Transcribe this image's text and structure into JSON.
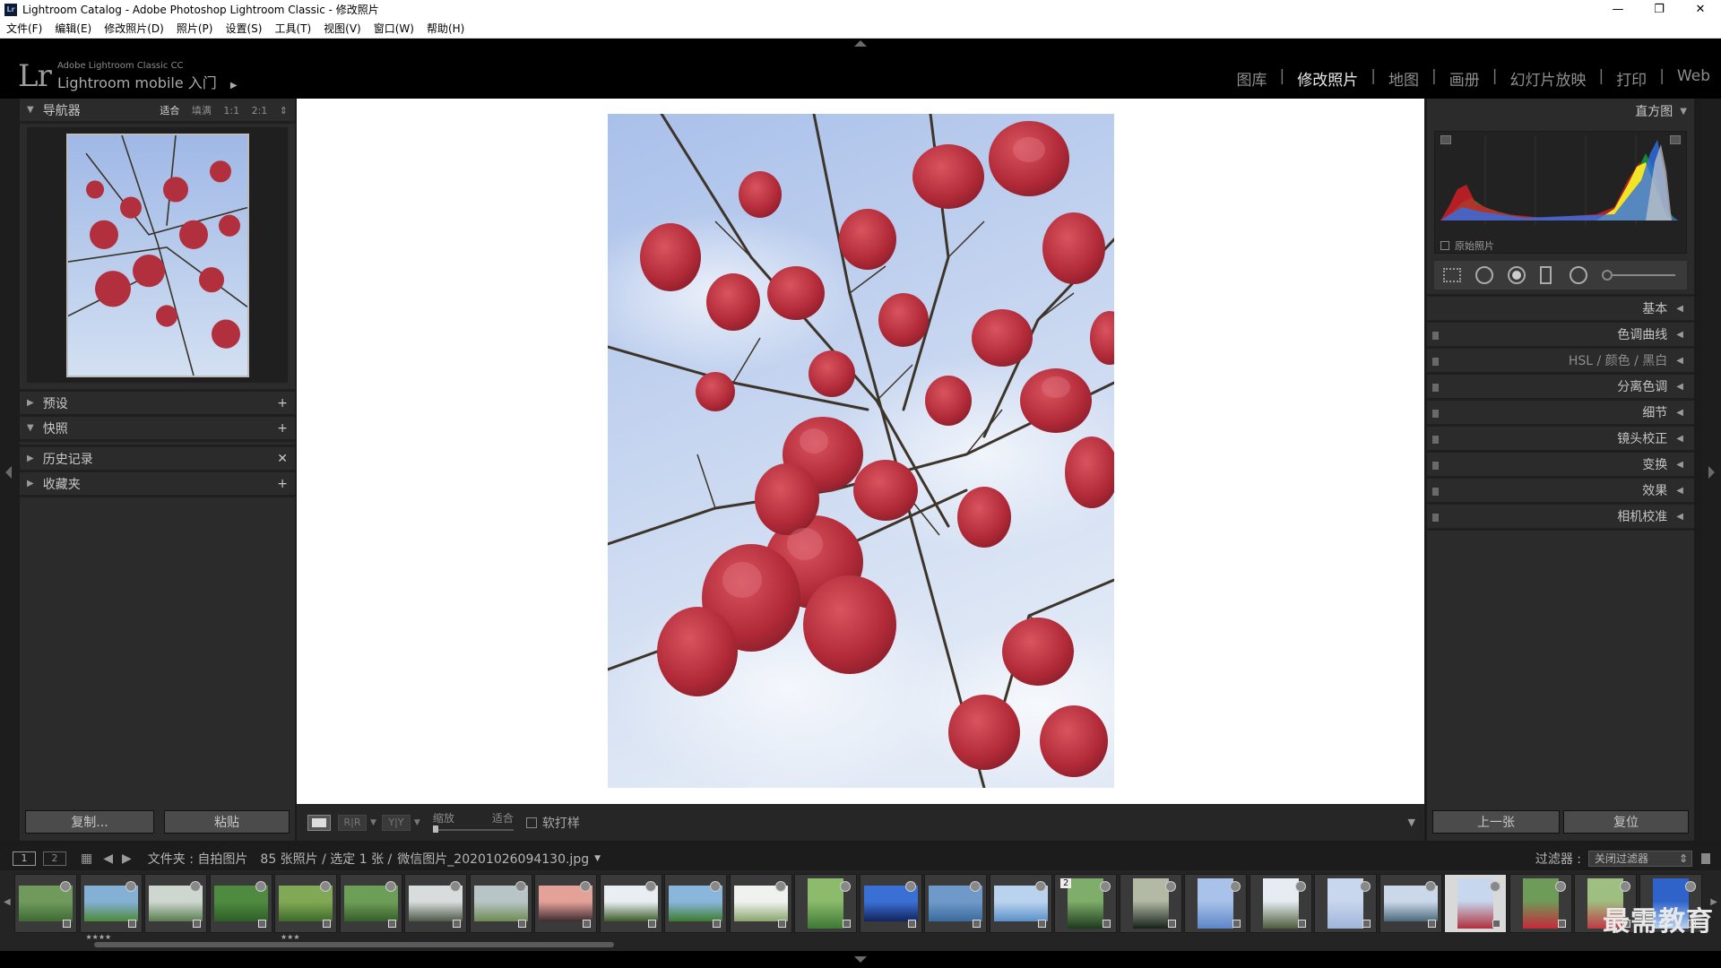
{
  "window": {
    "title": "Lightroom Catalog - Adobe Photoshop Lightroom Classic - 修改照片",
    "app_icon": "Lr",
    "controls": [
      "—",
      "❐",
      "✕"
    ]
  },
  "menu": [
    "文件(F)",
    "编辑(E)",
    "修改照片(D)",
    "照片(P)",
    "设置(S)",
    "工具(T)",
    "视图(V)",
    "窗口(W)",
    "帮助(H)"
  ],
  "identity": {
    "logo": "Lr",
    "small": "Adobe Lightroom Classic CC",
    "big": "Lightroom mobile 入门"
  },
  "modules": [
    {
      "label": "图库",
      "active": false
    },
    {
      "label": "修改照片",
      "active": true
    },
    {
      "label": "地图",
      "active": false
    },
    {
      "label": "画册",
      "active": false
    },
    {
      "label": "幻灯片放映",
      "active": false
    },
    {
      "label": "打印",
      "active": false
    },
    {
      "label": "Web",
      "active": false
    }
  ],
  "left": {
    "navigator": {
      "title": "导航器",
      "options": [
        "适合",
        "填满",
        "1:1",
        "2:1"
      ],
      "active_option": "适合"
    },
    "sections": [
      {
        "label": "预设",
        "action": "+",
        "expanded": false
      },
      {
        "label": "快照",
        "action": "+",
        "expanded": true
      },
      {
        "label": "历史记录",
        "action": "✕",
        "expanded": false
      },
      {
        "label": "收藏夹",
        "action": "+",
        "expanded": false
      }
    ],
    "copy_label": "复制...",
    "paste_label": "粘贴"
  },
  "right": {
    "histogram_title": "直方图",
    "original_photo": "原始照片",
    "sections": [
      "基本",
      "色调曲线",
      "HSL / 颜色 / 黑白",
      "分离色调",
      "细节",
      "镜头校正",
      "变换",
      "效果",
      "相机校准"
    ],
    "prev_label": "上一张",
    "reset_label": "复位"
  },
  "toolbar": {
    "zoom_label": "缩放",
    "fit_label": "适合",
    "softproof_label": "软打样"
  },
  "filmstrip_bar": {
    "page1": "1",
    "page2": "2",
    "path": "文件夹 : 自拍图片",
    "count": "85 张照片 / 选定 1 张 /",
    "filename": "微信图片_20201026094130.jpg",
    "filter_label": "过滤器 :",
    "filter_value": "关闭过滤器"
  },
  "filmstrip": {
    "thumbs": [
      {
        "type": "landscape",
        "colors": [
          "#6f9a5c",
          "#3f6a34"
        ]
      },
      {
        "type": "landscape",
        "colors": [
          "#85b0d6",
          "#4d8a3a"
        ],
        "stars": "★★★★"
      },
      {
        "type": "landscape",
        "colors": [
          "#cdd6cf",
          "#5a7d4f"
        ]
      },
      {
        "type": "landscape",
        "colors": [
          "#4e8a3f",
          "#2f5e28"
        ]
      },
      {
        "type": "landscape",
        "colors": [
          "#80a855",
          "#3f6b2b"
        ],
        "stars": "★★★"
      },
      {
        "type": "landscape",
        "colors": [
          "#6d9e58",
          "#355e2a"
        ]
      },
      {
        "type": "landscape",
        "colors": [
          "#d8dcdc",
          "#4e5a48"
        ]
      },
      {
        "type": "landscape",
        "colors": [
          "#b7c5c6",
          "#6e8a52"
        ]
      },
      {
        "type": "landscape",
        "colors": [
          "#e3a198",
          "#402b30"
        ]
      },
      {
        "type": "landscape",
        "colors": [
          "#e9eef2",
          "#3c5c2c"
        ]
      },
      {
        "type": "landscape",
        "colors": [
          "#8bb6dc",
          "#3d7b2f"
        ]
      },
      {
        "type": "landscape",
        "colors": [
          "#f0f2f0",
          "#8aa56a"
        ]
      },
      {
        "type": "portrait",
        "colors": [
          "#8cbb6c",
          "#3d7834"
        ]
      },
      {
        "type": "landscape",
        "colors": [
          "#3a6fd4",
          "#13245c"
        ]
      },
      {
        "type": "landscape",
        "colors": [
          "#6f99c9",
          "#3a6b9d"
        ]
      },
      {
        "type": "landscape",
        "colors": [
          "#b9d3ee",
          "#5b8fc8"
        ]
      },
      {
        "type": "portrait",
        "colors": [
          "#7fae6a",
          "#1e3a1c"
        ],
        "stack": "2"
      },
      {
        "type": "portrait",
        "colors": [
          "#b2b9a5",
          "#18221a"
        ]
      },
      {
        "type": "portrait",
        "colors": [
          "#a8c2ea",
          "#5e86c7"
        ]
      },
      {
        "type": "portrait",
        "colors": [
          "#e6ecf2",
          "#4e5d3c"
        ]
      },
      {
        "type": "portrait",
        "colors": [
          "#c8d6ee",
          "#9fb5d9"
        ]
      },
      {
        "type": "landscape",
        "colors": [
          "#cad8ea",
          "#4c6a7a"
        ]
      },
      {
        "type": "portrait",
        "colors": [
          "#c7d8ee",
          "#b0313d"
        ],
        "selected": true
      },
      {
        "type": "portrait",
        "colors": [
          "#6e9b58",
          "#c52a3a"
        ]
      },
      {
        "type": "portrait",
        "colors": [
          "#9fbf80",
          "#c13a45"
        ]
      },
      {
        "type": "portrait",
        "colors": [
          "#2f63c9",
          "#b6d2f2"
        ]
      }
    ]
  },
  "watermark": "最需教育",
  "colors": {
    "accent": "#e9e9e9",
    "panel": "#2b2b2b",
    "bg": "#1b1b1b"
  }
}
